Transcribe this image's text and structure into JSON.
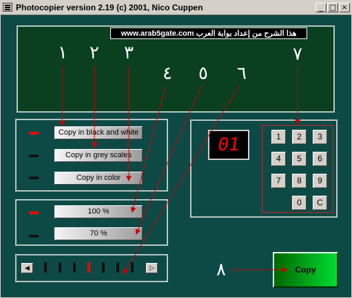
{
  "window": {
    "title": "Photocopier version 2.19 (c) 2001, Nico Cuppen"
  },
  "titlebar_buttons": {
    "minimize": "_",
    "maximize": "□",
    "close": "×"
  },
  "banner": {
    "text": "www.arab5gate.com هذا الشرح من إعداد بوابة العرب"
  },
  "annotations": [
    "١",
    "٢",
    "٣",
    "٤",
    "٥",
    "٦",
    "٧",
    "٨"
  ],
  "mode_buttons": [
    "Copy in black and white",
    "Copy in grey scales",
    "Copy in color"
  ],
  "mode_leds": [
    true,
    false,
    false
  ],
  "zoom_buttons": [
    "100 %",
    "70 %"
  ],
  "zoom_leds": [
    true,
    false
  ],
  "slider": {
    "left": "◀",
    "right": "▷",
    "positions": 7,
    "selected": 3
  },
  "display": {
    "value": "01"
  },
  "keypad": [
    "1",
    "2",
    "3",
    "4",
    "5",
    "6",
    "7",
    "8",
    "9",
    "0",
    "C"
  ],
  "copy_button": "Copy",
  "colors": {
    "led_on": "#ff0000",
    "led_off": "#111111",
    "arrow": "#cc0000",
    "copy_green": "#00dd33"
  }
}
